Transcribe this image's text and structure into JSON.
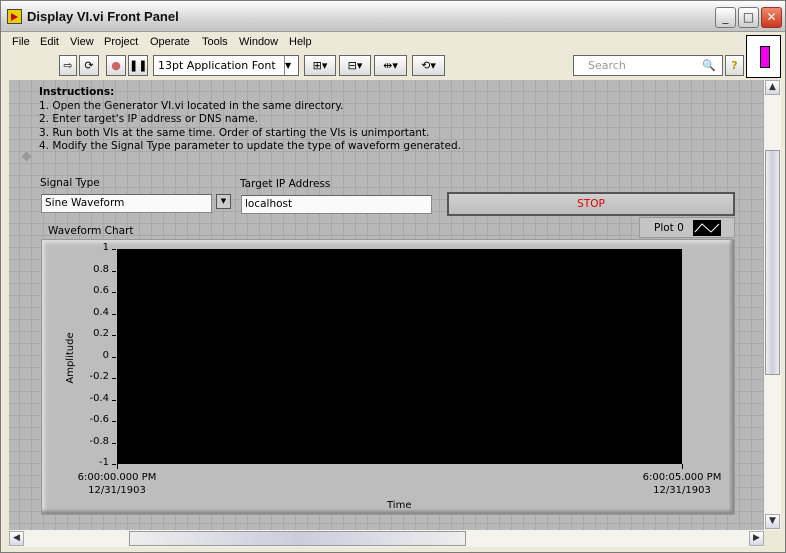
{
  "window": {
    "title": "Display VI.vi Front Panel"
  },
  "menu": [
    "File",
    "Edit",
    "View",
    "Project",
    "Operate",
    "Tools",
    "Window",
    "Help"
  ],
  "toolbar": {
    "font": "13pt Application Font",
    "search_placeholder": "Search",
    "help": "?"
  },
  "instructions": {
    "heading": "Instructions:",
    "lines": [
      "1. Open the Generator VI.vi located in the same directory.",
      "2. Enter target's IP address or DNS name.",
      "3. Run both VIs at the same time.  Order of starting the VIs is unimportant.",
      "4. Modify the Signal Type parameter to update the type of waveform generated."
    ]
  },
  "signal_type": {
    "label": "Signal Type",
    "value": "Sine Waveform"
  },
  "target_ip": {
    "label": "Target IP Address",
    "value": "localhost"
  },
  "stop_label": "STOP",
  "stop_color": "#e00000",
  "chart_data": {
    "type": "line",
    "title": "Waveform Chart",
    "legend": [
      "Plot 0"
    ],
    "xlabel": "Time",
    "ylabel": "Amplitude",
    "ylim": [
      -1,
      1
    ],
    "yticks": [
      "1",
      "0.8",
      "0.6",
      "0.4",
      "0.2",
      "0",
      "-0.2",
      "-0.4",
      "-0.6",
      "-0.8",
      "-1"
    ],
    "xticks": [
      {
        "time": "6:00:00.000 PM",
        "date": "12/31/1903"
      },
      {
        "time": "6:00:05.000 PM",
        "date": "12/31/1903"
      }
    ],
    "series": [
      {
        "name": "Plot 0",
        "values": []
      }
    ]
  }
}
